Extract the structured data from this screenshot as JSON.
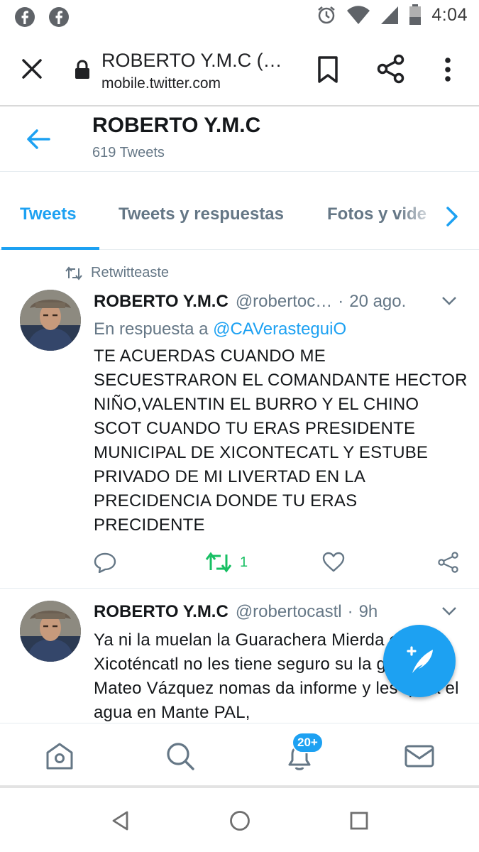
{
  "status_bar": {
    "time": "4:04",
    "left_icons": [
      "facebook-icon",
      "facebook-icon"
    ],
    "right_icons": [
      "alarm-icon",
      "wifi-icon",
      "signal-icon",
      "battery-icon"
    ]
  },
  "browser": {
    "title": "ROBERTO Y.M.C (…",
    "url": "mobile.twitter.com"
  },
  "profile": {
    "name": "ROBERTO Y.M.C",
    "tweet_count": "619 Tweets"
  },
  "tabs": [
    {
      "label": "Tweets",
      "active": true
    },
    {
      "label": "Tweets y respuestas",
      "active": false
    },
    {
      "label": "Fotos y vide",
      "active": false
    }
  ],
  "tweets": [
    {
      "context": "Retwitteaste",
      "author": "ROBERTO Y.M.C",
      "handle": "@robertoc…",
      "separator": "·",
      "time": "20 ago.",
      "reply_prefix": "En respuesta a",
      "reply_handle": "@CAVerasteguiO",
      "text": "TE ACUERDAS CUANDO ME SECUESTRARON EL COMANDANTE HECTOR NIÑO,VALENTIN EL BURRO Y EL CHINO SCOT CUANDO TU ERAS PRESIDENTE MUNICIPAL DE XICONTECATL Y ESTUBE PRIVADO DE MI LIVERTAD EN LA PRECIDENCIA DONDE TU ERAS PRECIDENTE",
      "retweet_count": "1"
    },
    {
      "author": "ROBERTO Y.M.C",
      "handle": "@robertocastl",
      "separator": "·",
      "time": "9h",
      "text": "Ya ni la muelan la Guarachera Mierda en Xicoténcatl no les tiene seguro su la gente y el Mateo Vázquez nomas da informe y les quita el agua en Mante PAL,"
    }
  ],
  "bottom_nav": {
    "notifications_badge": "20+"
  },
  "colors": {
    "accent": "#1da1f2",
    "retweet_green": "#17bf63",
    "secondary_text": "#657786"
  }
}
